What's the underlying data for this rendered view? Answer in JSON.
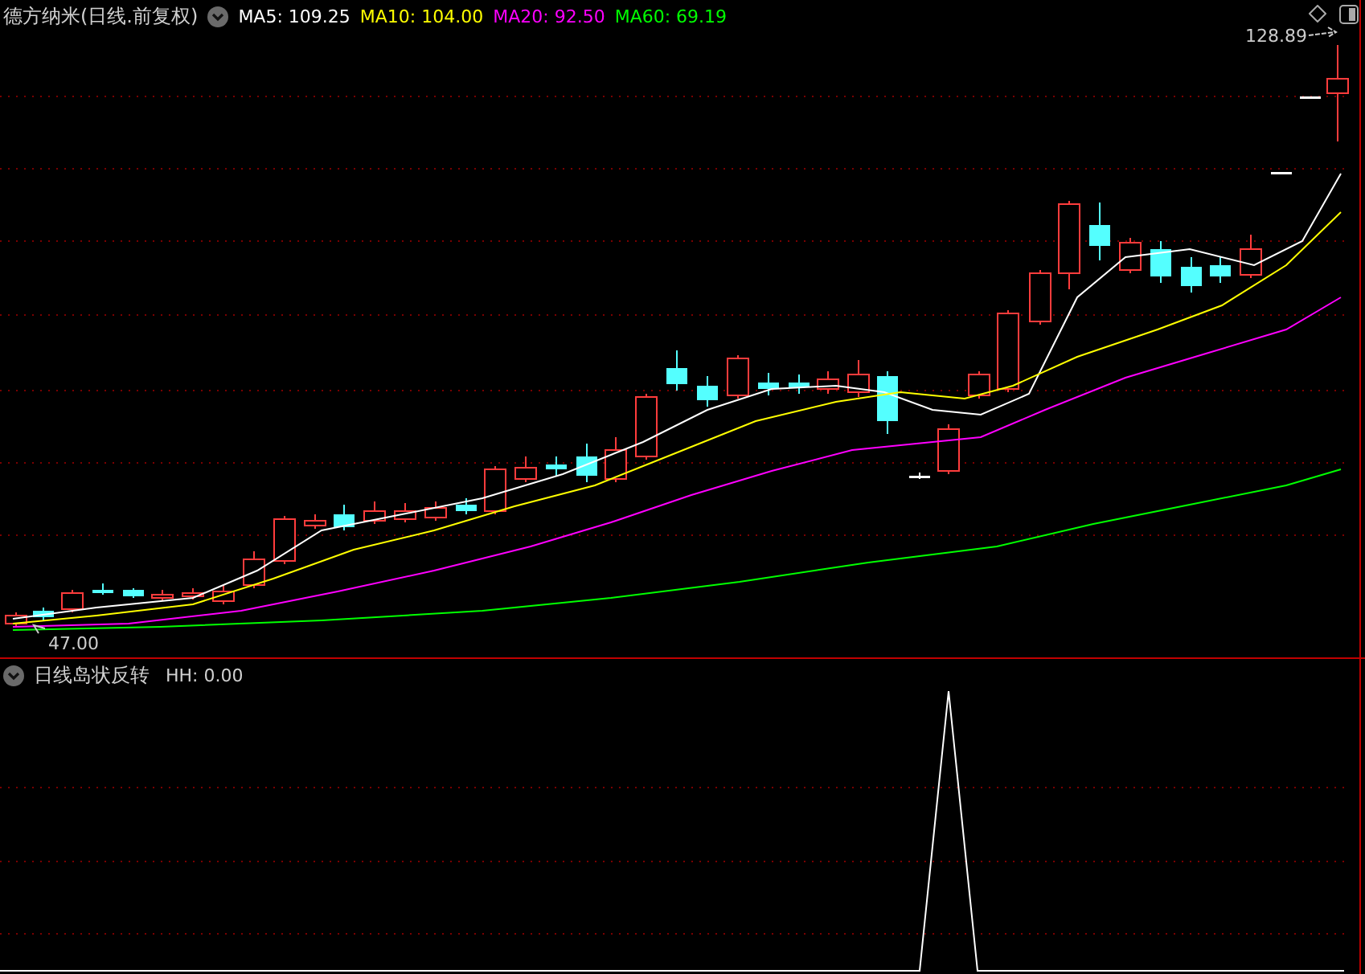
{
  "chart": {
    "title": "德方纳米(日线.前复权)",
    "indicators": [
      {
        "label": "MA5:",
        "value": "109.25",
        "color": "#ffffff"
      },
      {
        "label": "MA10:",
        "value": "104.00",
        "color": "#ffff00"
      },
      {
        "label": "MA20:",
        "value": "92.50",
        "color": "#ff00ff"
      },
      {
        "label": "MA60:",
        "value": "69.19",
        "color": "#00ff00"
      }
    ],
    "high_label": "128.89",
    "low_label": "47.00"
  },
  "indicator_panel": {
    "title": "日线岛状反转",
    "reading": "HH: 0.00"
  }
}
